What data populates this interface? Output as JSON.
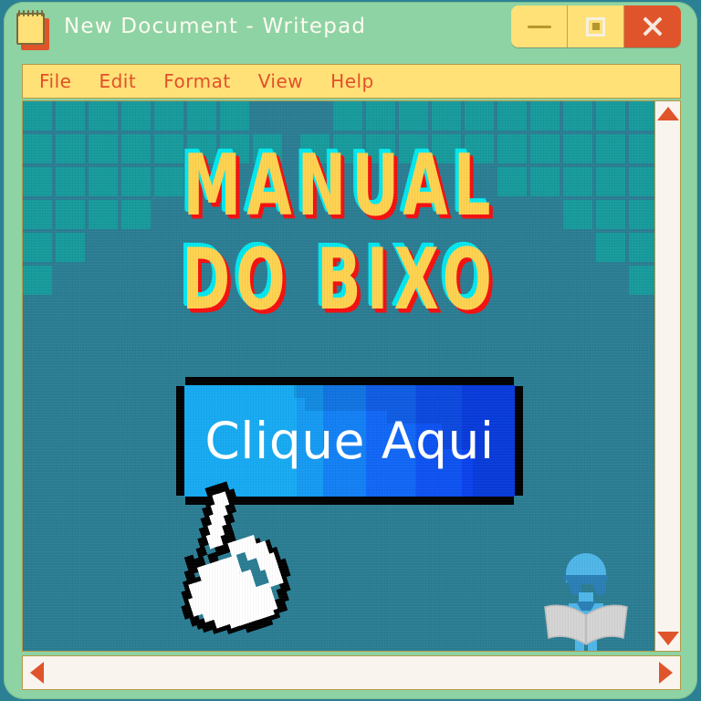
{
  "window": {
    "title": "New Document - Writepad",
    "icon": "notepad-icon",
    "controls": {
      "minimize": "minimize-icon",
      "maximize": "maximize-icon",
      "close": "close-icon"
    }
  },
  "menubar": {
    "items": [
      {
        "label": "File"
      },
      {
        "label": "Edit"
      },
      {
        "label": "Format"
      },
      {
        "label": "View"
      },
      {
        "label": "Help"
      }
    ]
  },
  "document": {
    "headline_line1": "MANUAL",
    "headline_line2": "DO BIXO",
    "cta_label": "Clique Aqui",
    "cursor": "pointing-hand-cursor",
    "mascot": "student-reading-book"
  },
  "scrollbars": {
    "vertical": {
      "up": "scroll-up-arrow",
      "down": "scroll-down-arrow"
    },
    "horizontal": {
      "left": "scroll-left-arrow",
      "right": "scroll-right-arrow"
    }
  },
  "colors": {
    "frame": "#8ed3a3",
    "menu_bg": "#ffe177",
    "menu_text": "#e2502a",
    "canvas": "#2b7d93",
    "grid_block": "#179a9c",
    "headline": "#ffd24f",
    "shadow_cyan": "#00e8ef",
    "shadow_red": "#f51010",
    "cta_light": "#17aaf2",
    "cta_dark": "#0a42ec",
    "accent_orange": "#e0542b",
    "scroll_track": "#faf4ee"
  }
}
